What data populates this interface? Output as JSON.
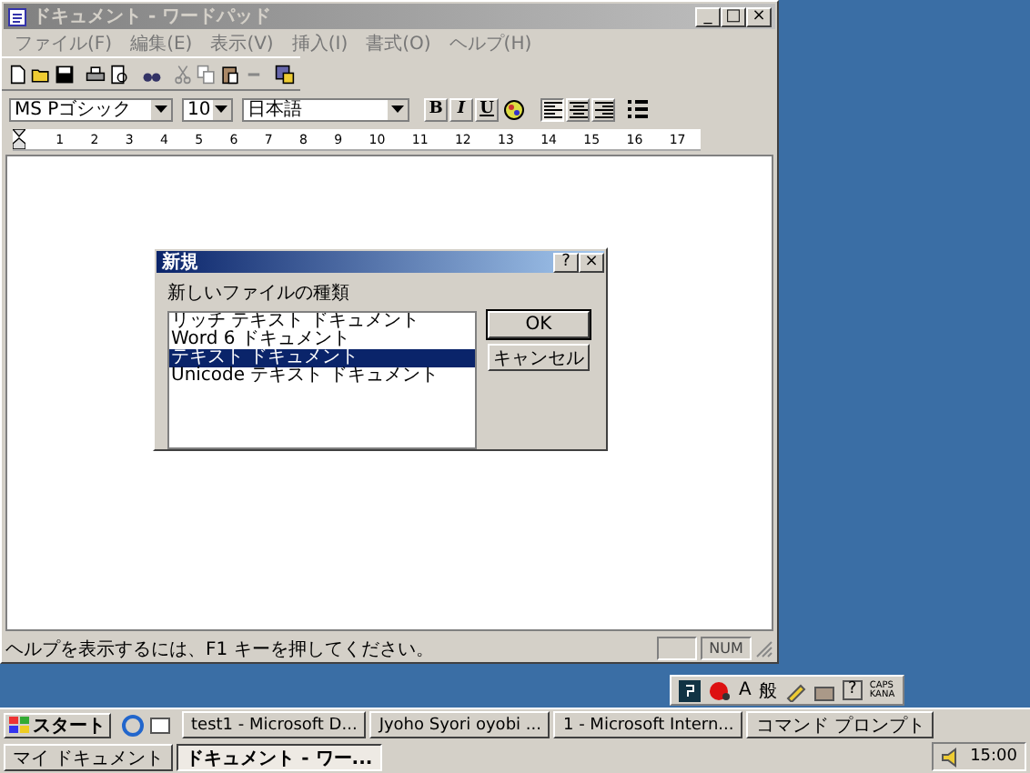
{
  "window": {
    "title": "ドキュメント - ワードパッド",
    "active": false,
    "controls": [
      "_",
      "□",
      "×"
    ]
  },
  "menu": [
    "ファイル(F)",
    "編集(E)",
    "表示(V)",
    "挿入(I)",
    "書式(O)",
    "ヘルプ(H)"
  ],
  "format_bar": {
    "font": "MS Pゴシック",
    "size": "10",
    "script": "日本語",
    "styles": [
      {
        "label": "B",
        "kind": "bold"
      },
      {
        "label": "I",
        "kind": "italic"
      },
      {
        "label": "U",
        "kind": "underline"
      }
    ],
    "align": [
      {
        "kind": "left",
        "selected": true
      },
      {
        "kind": "center",
        "selected": false
      },
      {
        "kind": "right",
        "selected": false
      }
    ]
  },
  "ruler": {
    "labels": [
      "1",
      "2",
      "3",
      "4",
      "5",
      "6",
      "7",
      "8",
      "9",
      "10",
      "11",
      "12",
      "13",
      "14",
      "15",
      "16",
      "17"
    ]
  },
  "dialog": {
    "title": "新規",
    "active": true,
    "help": "?",
    "close": "×",
    "label": "新しいファイルの種類",
    "items": [
      {
        "label": "リッチ テキスト ドキュメント",
        "selected": false
      },
      {
        "label": "Word 6 ドキュメント",
        "selected": false
      },
      {
        "label": "テキスト ドキュメント",
        "selected": true
      },
      {
        "label": "Unicode テキスト ドキュメント",
        "selected": false
      }
    ],
    "buttons": [
      "OK",
      "キャンセル"
    ]
  },
  "status_bar": {
    "text": "ヘルプを表示するには、F1 キーを押してください。",
    "num": "NUM"
  },
  "ime_bar": {
    "mode": "A",
    "dictionary": "般",
    "help": "?",
    "caps": "CAPS",
    "kana": "KANA"
  },
  "taskbar": {
    "start": "スタート",
    "tasks": [
      {
        "label": "test1 - Microsoft D...",
        "selected": false
      },
      {
        "label": "Jyoho Syori oyobi ...",
        "selected": false
      },
      {
        "label": "1 - Microsoft Intern...",
        "selected": false
      },
      {
        "label": "コマンド プロンプト",
        "selected": false
      },
      {
        "label": "マイ ドキュメント",
        "selected": false
      },
      {
        "label": "ドキュメント - ワー...",
        "selected": true
      }
    ],
    "clock": "15:00"
  }
}
